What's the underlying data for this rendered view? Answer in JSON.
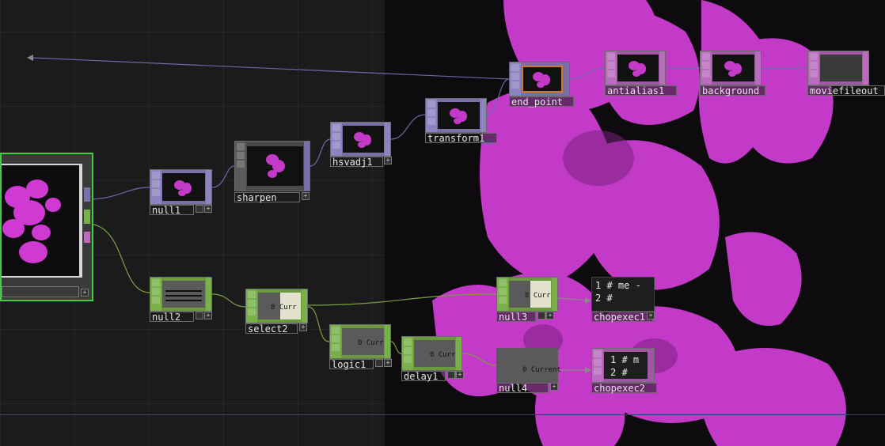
{
  "colors": {
    "top_family": "#7b6fa8",
    "chop_family": "#6a9a3c",
    "dat_family": "#a05aa5",
    "selected_border": "#3fcf3f",
    "wire_top": "#6a6aa8",
    "wire_chop": "#7aa043",
    "flower": "#d23fd6"
  },
  "nodes": {
    "null1": {
      "label": "null1"
    },
    "sharpen": {
      "label": "sharpen"
    },
    "hsvadj1": {
      "label": "hsvadj1"
    },
    "transform1": {
      "label": "transform1"
    },
    "end_point": {
      "label": "end_point"
    },
    "antialias1": {
      "label": "antialias1"
    },
    "background": {
      "label": "background"
    },
    "moviefileout": {
      "label": "moviefileout"
    },
    "null2": {
      "label": "null2"
    },
    "select2": {
      "label": "select2",
      "value": "8 Curr"
    },
    "logic1": {
      "label": "logic1",
      "value": "0 Curr"
    },
    "delay1": {
      "label": "delay1",
      "value": "0 Curr"
    },
    "null3": {
      "label": "null3",
      "value": "8 Curr"
    },
    "null4": {
      "label": "null4",
      "value": "0 Current"
    },
    "chopexec1": {
      "label": "chopexec1",
      "lines": [
        "1 # me -",
        "2 #"
      ]
    },
    "chopexec2": {
      "label": "chopexec2",
      "lines": [
        "1 # m",
        "2 #"
      ]
    }
  },
  "icons": [
    "flower-thumbnail-icon",
    "plus-icon",
    "viewer-toggle-icon"
  ]
}
